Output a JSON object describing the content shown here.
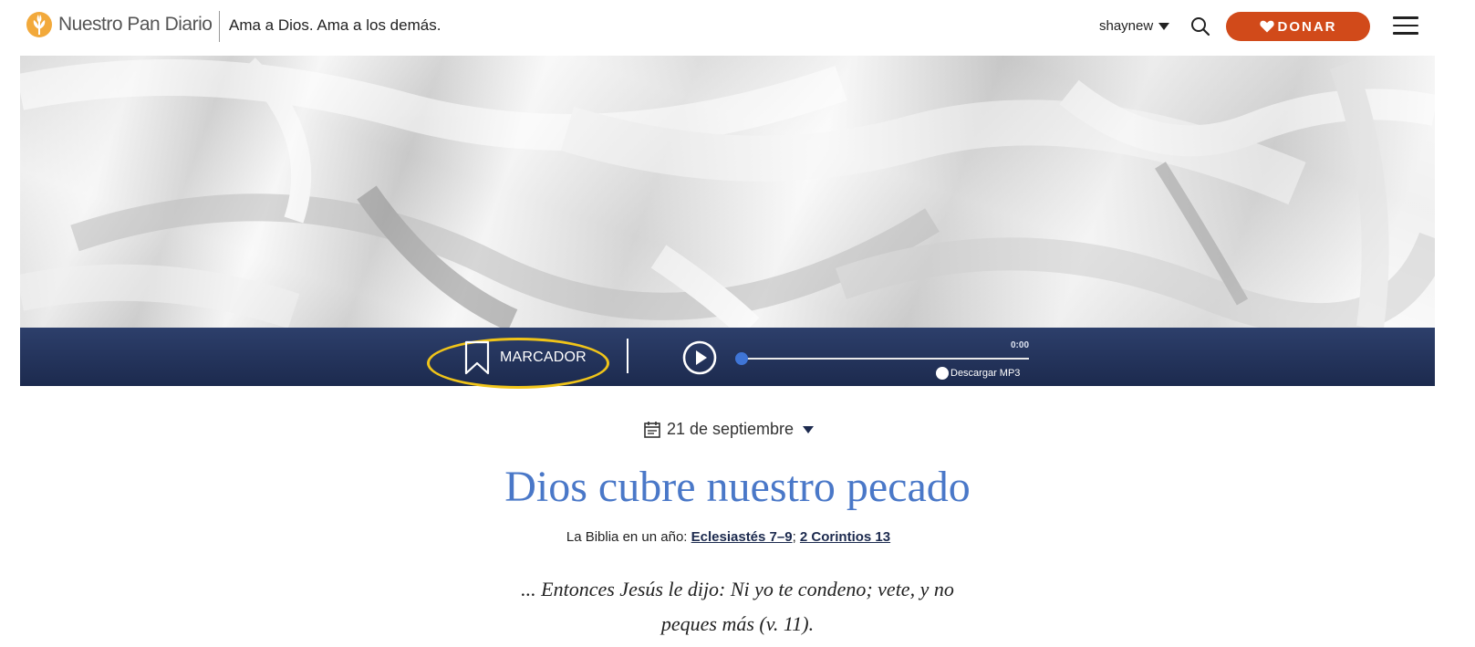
{
  "header": {
    "logo_text": "Nuestro Pan Diario",
    "tagline": "Ama a Dios. Ama a los demás.",
    "username": "shaynew",
    "donate_label": "DONAR",
    "icons": {
      "logo": "wheat-leaf-icon",
      "search": "search-icon",
      "menu": "hamburger-menu-icon",
      "heart": "heart-icon"
    },
    "colors": {
      "donate_bg": "#d14a1a"
    }
  },
  "audio": {
    "bookmark_label": "MARCADOR",
    "time": "0:00",
    "download_label": "Descargar MP3",
    "progress": 0,
    "colors": {
      "bar_bg": "#1c2a4e",
      "highlight_ring": "#f0c419",
      "handle": "#3f75d6"
    }
  },
  "devotional": {
    "date": "21 de septiembre",
    "title": "Dios cubre nuestro pecado",
    "bible_year_prefix": "La Biblia en un año:",
    "bible_year_link1": "Eclesiastés 7–9",
    "bible_year_sep": ";",
    "bible_year_link2": "2 Corintios 13",
    "verse_line1": "... Entonces Jesús le dijo: Ni yo te condeno; vete, y no",
    "verse_line2": "peques más (v. 11).",
    "colors": {
      "title": "#4a78c8"
    }
  }
}
